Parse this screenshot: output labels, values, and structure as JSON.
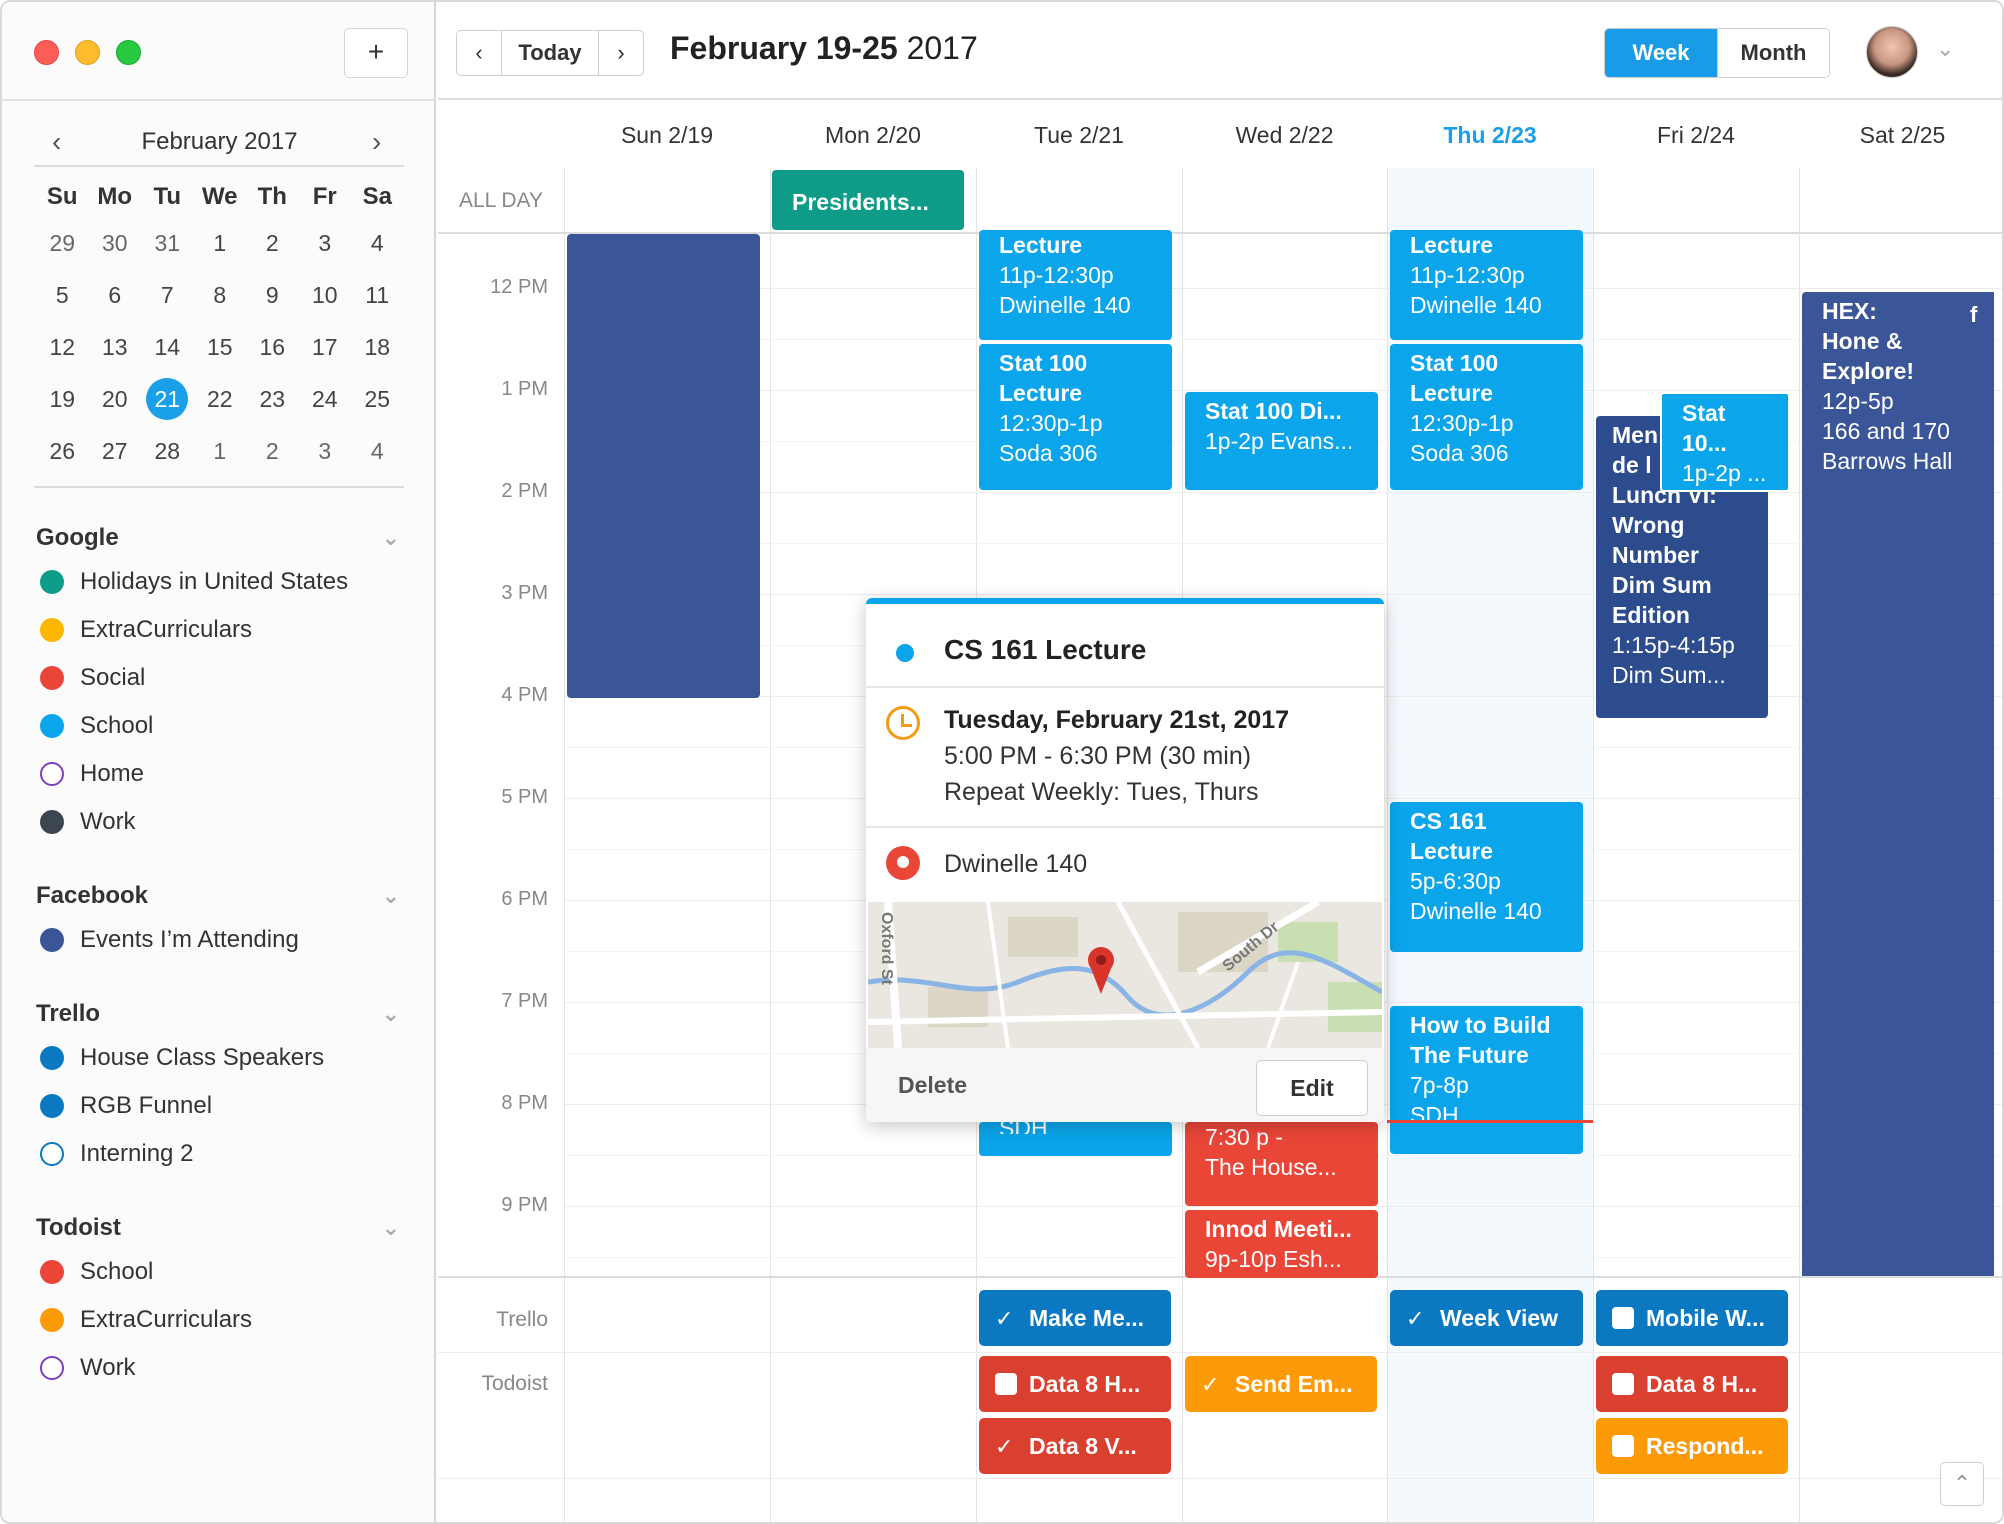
{
  "sidebar": {
    "add_label": "+",
    "mini_calendar": {
      "title": "February 2017",
      "prev": "‹",
      "next": "›",
      "weekdays": [
        "Su",
        "Mo",
        "Tu",
        "We",
        "Th",
        "Fr",
        "Sa"
      ],
      "weeks": [
        [
          "29",
          "30",
          "31",
          "1",
          "2",
          "3",
          "4"
        ],
        [
          "5",
          "6",
          "7",
          "8",
          "9",
          "10",
          "11"
        ],
        [
          "12",
          "13",
          "14",
          "15",
          "16",
          "17",
          "18"
        ],
        [
          "19",
          "20",
          "21",
          "22",
          "23",
          "24",
          "25"
        ],
        [
          "26",
          "27",
          "28",
          "1",
          "2",
          "3",
          "4"
        ]
      ],
      "selected": "21"
    },
    "groups": [
      {
        "title": "Google",
        "items": [
          {
            "label": "Holidays in United States",
            "color": "#0e9c89",
            "filled": true
          },
          {
            "label": "ExtraCurriculars",
            "color": "#fdb702",
            "filled": true
          },
          {
            "label": "Social",
            "color": "#e94638",
            "filled": true
          },
          {
            "label": "School",
            "color": "#0aa5ea",
            "filled": true
          },
          {
            "label": "Home",
            "color": "#7b3fbe",
            "filled": false
          },
          {
            "label": "Work",
            "color": "#3b4650",
            "filled": true
          }
        ]
      },
      {
        "title": "Facebook",
        "items": [
          {
            "label": "Events I’m Attending",
            "color": "#3a5698",
            "filled": true
          }
        ]
      },
      {
        "title": "Trello",
        "items": [
          {
            "label": "House Class Speakers",
            "color": "#0a79c2",
            "filled": true
          },
          {
            "label": "RGB Funnel",
            "color": "#0a79c2",
            "filled": true
          },
          {
            "label": "Interning 2",
            "color": "#0a79c2",
            "filled": false
          }
        ]
      },
      {
        "title": "Todoist",
        "items": [
          {
            "label": "School",
            "color": "#e94638",
            "filled": true
          },
          {
            "label": "ExtraCurriculars",
            "color": "#fd9a08",
            "filled": true
          },
          {
            "label": "Work",
            "color": "#7b3fbe",
            "filled": false
          }
        ]
      }
    ]
  },
  "header": {
    "prev": "‹",
    "today": "Today",
    "next": "›",
    "title_bold": "February 19-25",
    "title_year": "2017",
    "view_week": "Week",
    "view_month": "Month",
    "avatar_chevron": "⌄"
  },
  "days": [
    "Sun 2/19",
    "Mon 2/20",
    "Tue 2/21",
    "Wed 2/22",
    "Thu 2/23",
    "Fri 2/24",
    "Sat 2/25"
  ],
  "today_index": 4,
  "allday_label": "ALL DAY",
  "hours": [
    "12 PM",
    "1 PM",
    "2 PM",
    "3 PM",
    "4 PM",
    "5 PM",
    "6 PM",
    "7 PM",
    "8 PM",
    "9 PM"
  ],
  "allday_events": [
    {
      "title": "Presidents...",
      "day": 1
    }
  ],
  "events": {
    "tue_lecture": {
      "lines": [
        "Lecture",
        "11p-12:30p",
        "Dwinelle 140"
      ]
    },
    "tue_stat": {
      "lines": [
        "Stat 100",
        "Lecture",
        "12:30p-1p",
        "Soda 306"
      ]
    },
    "tue_sdh": {
      "lines": [
        "SDH"
      ]
    },
    "wed_stat": {
      "lines": [
        "Stat 100 Di...",
        "1p-2p  Evans..."
      ]
    },
    "wed_house": {
      "lines": [
        "7:30 p -",
        "The House..."
      ]
    },
    "wed_innod": {
      "lines": [
        "Innod Meeti...",
        "9p-10p  Esh..."
      ]
    },
    "thu_lecture": {
      "lines": [
        "Lecture",
        "11p-12:30p",
        "Dwinelle 140"
      ]
    },
    "thu_stat": {
      "lines": [
        "Stat 100",
        "Lecture",
        "12:30p-1p",
        "Soda 306"
      ]
    },
    "thu_cs161": {
      "lines": [
        "CS 161",
        "Lecture",
        "5p-6:30p",
        "Dwinelle 140"
      ]
    },
    "thu_build": {
      "lines": [
        "How to Build",
        "The Future",
        "7p-8p",
        "SDH"
      ]
    },
    "fri_lunch": {
      "lines": [
        "Men",
        "de l",
        "Lunch VI:",
        "Wrong",
        "Number",
        "Dim Sum",
        "Edition",
        "1:15p-4:15p",
        "Dim Sum..."
      ]
    },
    "fri_stat": {
      "lines": [
        "Stat 10...",
        "1p-2p  ..."
      ]
    },
    "sat_hex": {
      "lines": [
        "HEX:",
        "Hone &",
        "Explore!",
        "12p-5p",
        "166 and 170",
        "Barrows Hall"
      ],
      "icon": "f"
    }
  },
  "rows": {
    "trello_label": "Trello",
    "todoist_label": "Todoist",
    "trello_tasks": [
      {
        "label": "Make Me...",
        "done": true
      },
      {
        "label": "Week View",
        "done": true
      },
      {
        "label": "Mobile W...",
        "done": false
      }
    ],
    "todoist_tasks": [
      {
        "label": "Data 8 H...",
        "done": false
      },
      {
        "label": "Send Em...",
        "done": true
      },
      {
        "label": "Data 8 H...",
        "done": false
      },
      {
        "label": "Data 8 V...",
        "done": true
      },
      {
        "label": "Respond...",
        "done": false
      }
    ]
  },
  "popover": {
    "title": "CS 161 Lecture",
    "date": "Tuesday, February 21st, 2017",
    "time": "5:00 PM - 6:30 PM (30 min)",
    "repeat": "Repeat Weekly: Tues, Thurs",
    "location": "Dwinelle 140",
    "map_labels": [
      "Oxford St",
      "South Dr"
    ],
    "delete": "Delete",
    "edit": "Edit"
  },
  "scroll_top": "⌃",
  "colors": {
    "school": "#0aa5ea",
    "facebook": "#3a5698",
    "social": "#e94638",
    "holidays": "#0e9c89",
    "trello": "#0a79c2",
    "todoist_red": "#d9402f",
    "todoist_orange": "#fd9a08",
    "accent": "#1a9be8"
  }
}
